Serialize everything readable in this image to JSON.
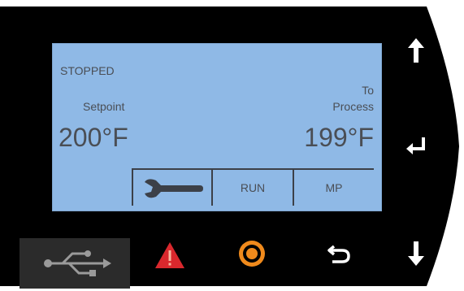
{
  "screen": {
    "status": "STOPPED",
    "setpoint": {
      "label": "Setpoint",
      "value": "200°F"
    },
    "to_process": {
      "label_line1": "To",
      "label_line2": "Process",
      "value": "199°F"
    },
    "softkeys": {
      "wrench_icon": "wrench-icon",
      "run_label": "RUN",
      "mp_label": "MP"
    }
  },
  "buttons": {
    "usb": "usb-icon",
    "alarm": "warning-triangle-icon",
    "target": "target-icon",
    "back": "return-icon",
    "up": "arrow-up-icon",
    "enter": "enter-icon",
    "down": "arrow-down-icon"
  },
  "colors": {
    "screen_bg": "#8fb9e6",
    "screen_text": "#4a4e55",
    "bezel": "#000000",
    "alarm_red": "#d9282d",
    "target_orange": "#f08a1c"
  }
}
